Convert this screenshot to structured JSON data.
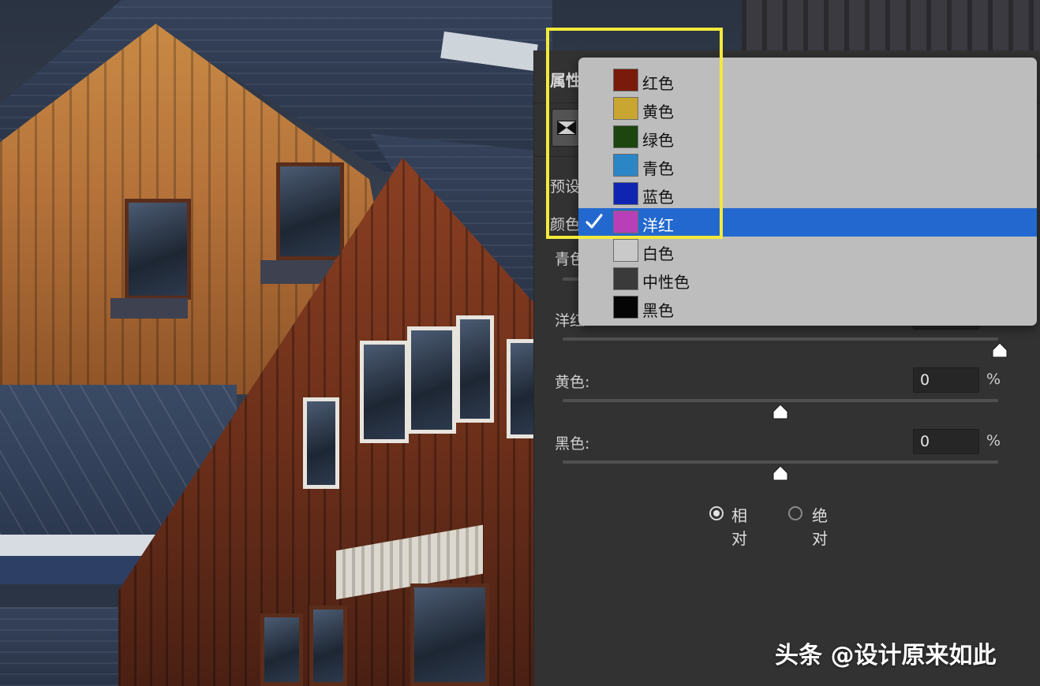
{
  "panel": {
    "title": "属性",
    "preset_label": "预设",
    "colors_label": "颜色",
    "sliders": [
      {
        "label": "青色:",
        "value": "",
        "unit": "%"
      },
      {
        "label": "洋红:",
        "value": "",
        "unit": "%"
      },
      {
        "label": "黄色:",
        "value": "0",
        "unit": "%"
      },
      {
        "label": "黑色:",
        "value": "0",
        "unit": "%"
      }
    ],
    "radio": {
      "relative_label": "相对",
      "absolute_label": "绝对",
      "selected": "relative"
    }
  },
  "dropdown": {
    "selected_index": 5,
    "items": [
      {
        "label": "红色",
        "color": "#7a1a0c"
      },
      {
        "label": "黄色",
        "color": "#c9a531"
      },
      {
        "label": "绿色",
        "color": "#1c4510"
      },
      {
        "label": "青色",
        "color": "#2c86c5"
      },
      {
        "label": "蓝色",
        "color": "#0f25b2"
      },
      {
        "label": "洋红",
        "color": "#b93fb8"
      },
      {
        "label": "白色",
        "color": "#c9c9c9"
      },
      {
        "label": "中性色",
        "color": "#3a3a3a"
      },
      {
        "label": "黑色",
        "color": "#050505"
      }
    ]
  },
  "watermark": "头条 @设计原来如此",
  "colors": {
    "panel_bg": "#323232",
    "menu_bg": "#bdbdbd",
    "selection": "#2368cf",
    "highlight": "#f3ea3a"
  }
}
